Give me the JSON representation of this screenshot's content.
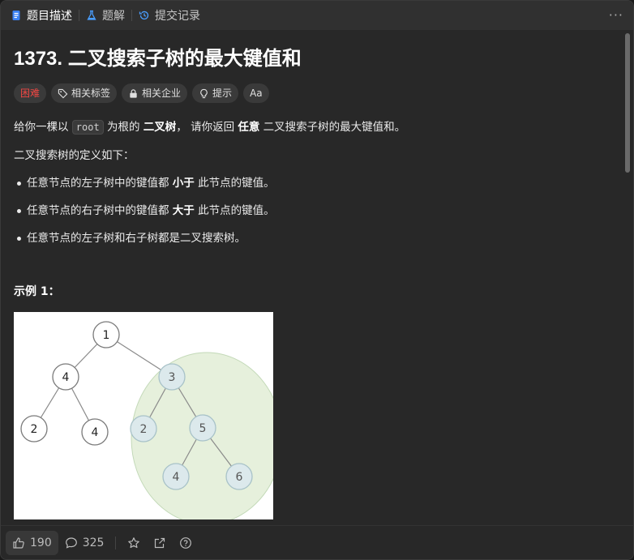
{
  "tabs": [
    {
      "label": "题目描述",
      "icon": "description-icon"
    },
    {
      "label": "题解",
      "icon": "flask-icon"
    },
    {
      "label": "提交记录",
      "icon": "history-icon"
    }
  ],
  "more_label": "···",
  "problem": {
    "title": "1373. 二叉搜索子树的最大键值和",
    "difficulty": "困难",
    "tags": [
      "相关标签",
      "相关企业",
      "提示",
      "Aa"
    ]
  },
  "description": {
    "p1_a": "给你一棵以 ",
    "p1_code": "root",
    "p1_b": " 为根的 ",
    "p1_bold1": "二叉树",
    "p1_c": "， 请你返回 ",
    "p1_bold2": "任意",
    "p1_d": " 二叉搜索子树的最大键值和。",
    "p2": "二叉搜索树的定义如下：",
    "bullets": [
      {
        "a": "任意节点的左子树中的键值都 ",
        "bold": "小于",
        "b": " 此节点的键值。"
      },
      {
        "a": "任意节点的右子树中的键值都 ",
        "bold": "大于",
        "b": " 此节点的键值。"
      },
      {
        "a": "任意节点的左子树和右子树都是二叉搜索树。",
        "bold": "",
        "b": ""
      }
    ]
  },
  "example": {
    "title": "示例 1：",
    "tree_nodes": [
      "1",
      "4",
      "3",
      "2",
      "4",
      "2",
      "5",
      "4",
      "6"
    ]
  },
  "bottom": {
    "likes": "190",
    "comments": "325"
  },
  "colors": {
    "hard": "#ef4743",
    "highlight_fill": "#e6f0dc",
    "highlight_node": "#dce9ec"
  }
}
